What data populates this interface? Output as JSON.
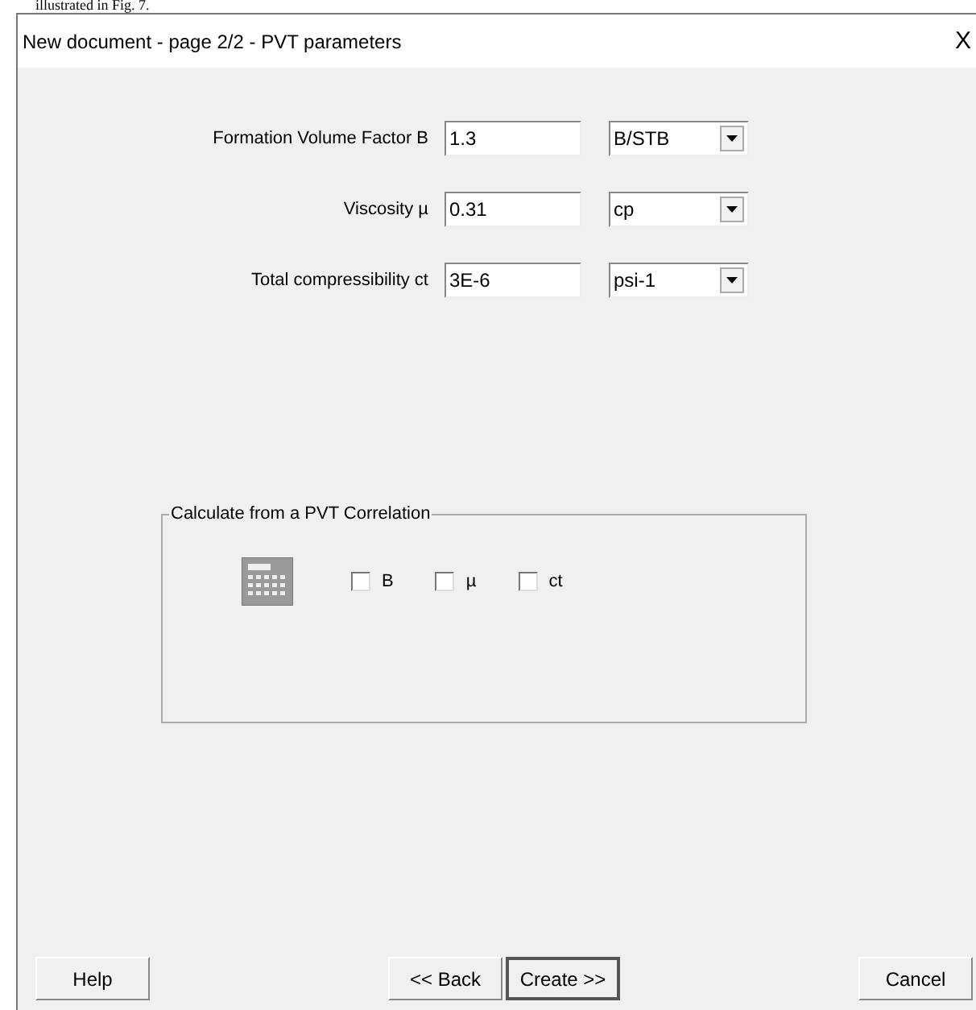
{
  "caption_above": "illustrated in Fig. 7.",
  "window": {
    "title": "New document - page 2/2 - PVT parameters",
    "close": "X"
  },
  "parameters": [
    {
      "label": "Formation Volume Factor B",
      "value": "1.3",
      "unit": "B/STB"
    },
    {
      "label": "Viscosity µ",
      "value": "0.31",
      "unit": "cp"
    },
    {
      "label": "Total compressibility ct",
      "value": "3E-6",
      "unit": "psi-1"
    }
  ],
  "correlation_group": {
    "title": "Calculate from a PVT Correlation",
    "checkboxes": [
      {
        "label": "B",
        "checked": false
      },
      {
        "label": "µ",
        "checked": false
      },
      {
        "label": "ct",
        "checked": false
      }
    ]
  },
  "buttons": [
    {
      "label": "Help",
      "default": false
    },
    {
      "label": "<< Back",
      "default": false
    },
    {
      "label": "Create >>",
      "default": true
    },
    {
      "label": "Cancel",
      "default": false
    }
  ]
}
